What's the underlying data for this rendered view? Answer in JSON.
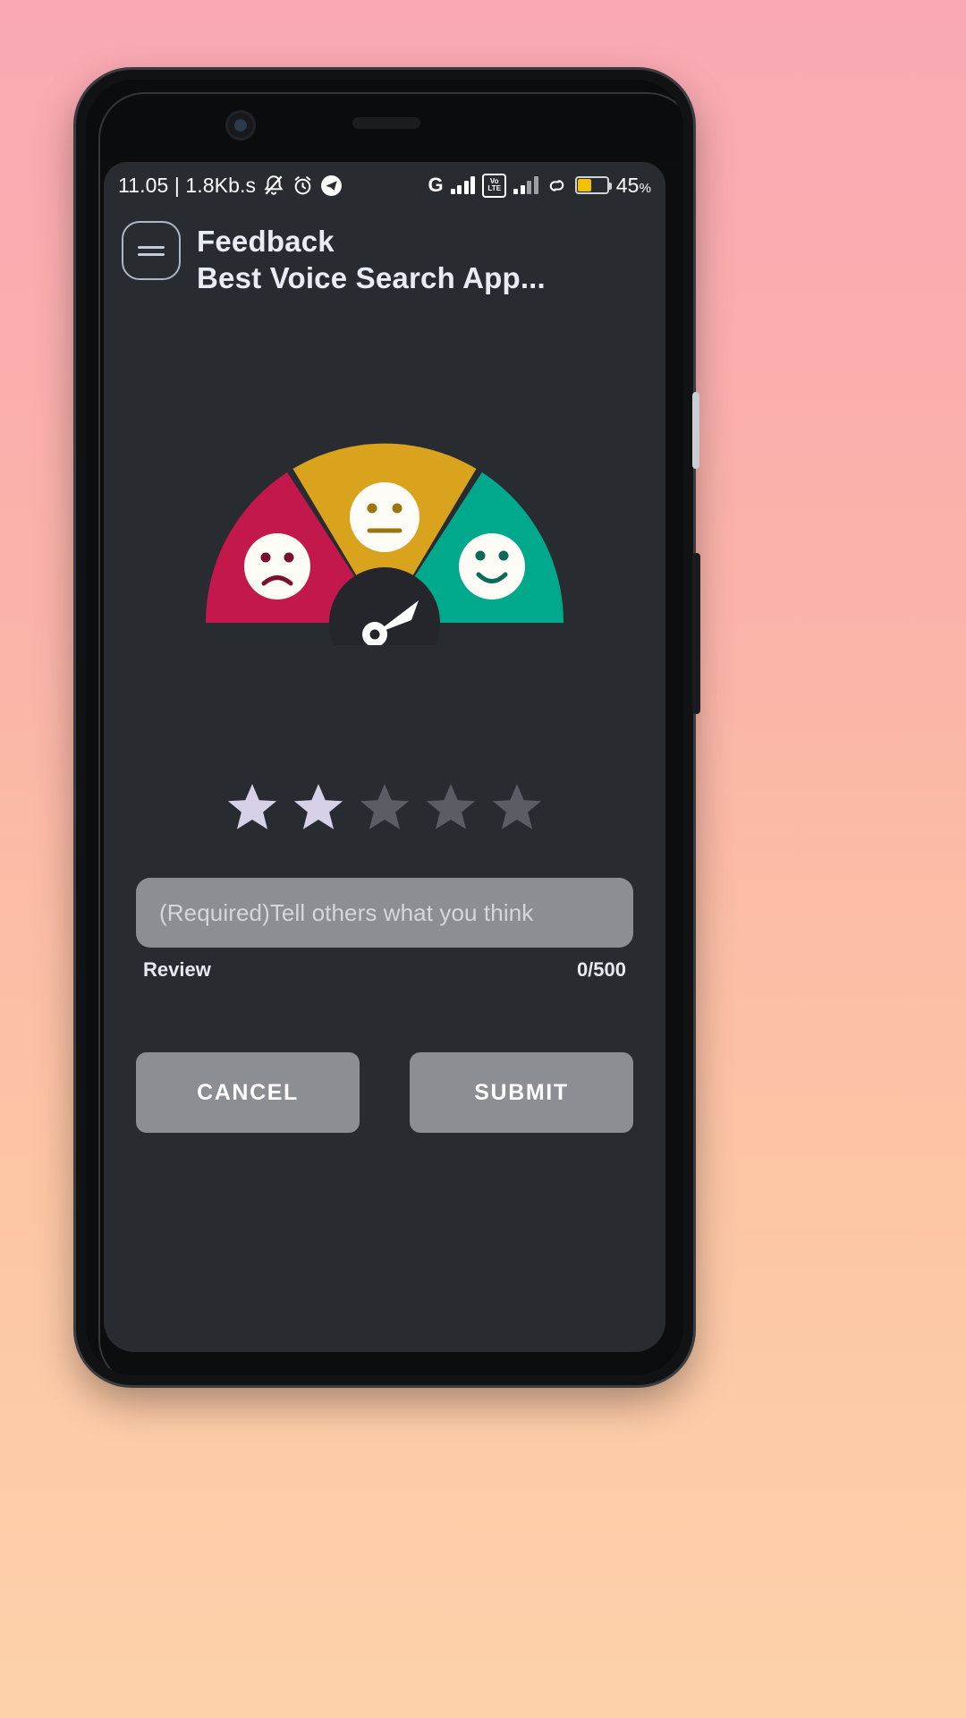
{
  "statusbar": {
    "time_and_data": "11.05 | 1.8Kb.s",
    "icons": [
      "mute-bell-icon",
      "alarm-clock-icon",
      "telegram-icon",
      "network-4g-icon",
      "signal-bars-icon",
      "volte-icon",
      "signal-bars-secondary-icon",
      "link-icon"
    ],
    "network_label": "G",
    "volte_top": "Vo",
    "volte_bottom": "LTE",
    "battery_percent": "45",
    "battery_percent_suffix": "%",
    "battery_level": 45,
    "battery_color": "#f2c200"
  },
  "appbar": {
    "menu_icon": "hamburger-menu-icon",
    "title": "Feedback",
    "subtitle": "Best Voice Search App..."
  },
  "gauge": {
    "segments": [
      {
        "name": "negative",
        "color": "#c2184c",
        "face": "sad-face-icon"
      },
      {
        "name": "neutral",
        "color": "#d9a31e",
        "face": "neutral-face-icon"
      },
      {
        "name": "positive",
        "color": "#00a98c",
        "face": "happy-face-icon"
      }
    ],
    "hub_color": "#24262b",
    "needle_color": "#ffffff",
    "needle_angle_deg": 38
  },
  "rating": {
    "max": 5,
    "value": 2,
    "filled_color": "#d6d0e8",
    "empty_color": "#5a5d63"
  },
  "review": {
    "placeholder": "(Required)Tell others what you think",
    "value": "",
    "label": "Review",
    "counter": "0/500"
  },
  "actions": {
    "cancel_label": "CANCEL",
    "submit_label": "SUBMIT"
  }
}
